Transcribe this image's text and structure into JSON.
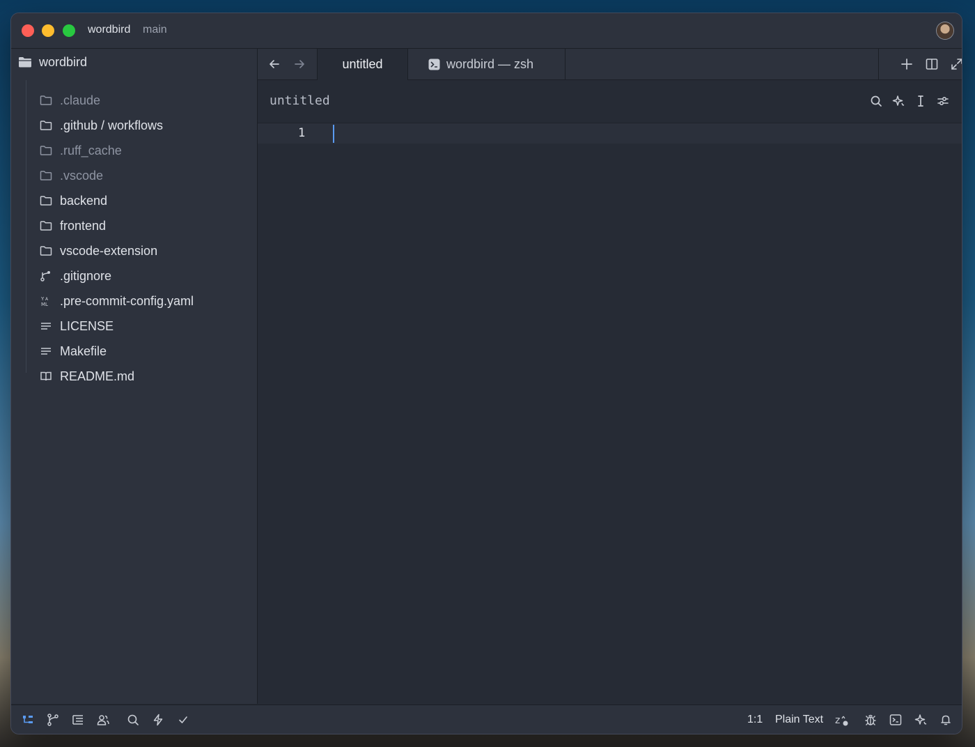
{
  "titlebar": {
    "project": "wordbird",
    "branch": "main"
  },
  "sidebar": {
    "root": "wordbird",
    "items": [
      {
        "label": ".claude",
        "icon": "folder-icon",
        "dim": true
      },
      {
        "label": ".github / workflows",
        "icon": "folder-icon",
        "dim": false
      },
      {
        "label": ".ruff_cache",
        "icon": "folder-icon",
        "dim": true
      },
      {
        "label": ".vscode",
        "icon": "folder-icon",
        "dim": true
      },
      {
        "label": "backend",
        "icon": "folder-icon",
        "dim": false
      },
      {
        "label": "frontend",
        "icon": "folder-icon",
        "dim": false
      },
      {
        "label": "vscode-extension",
        "icon": "folder-icon",
        "dim": false
      },
      {
        "label": ".gitignore",
        "icon": "git-branch-icon",
        "dim": false
      },
      {
        "label": ".pre-commit-config.yaml",
        "icon": "yaml-file-icon",
        "dim": false
      },
      {
        "label": "LICENSE",
        "icon": "text-lines-icon",
        "dim": false
      },
      {
        "label": "Makefile",
        "icon": "text-lines-icon",
        "dim": false
      },
      {
        "label": "README.md",
        "icon": "book-icon",
        "dim": false
      }
    ]
  },
  "tabs": [
    {
      "label": "untitled",
      "active": true
    },
    {
      "label": "wordbird — zsh",
      "icon": "terminal-icon",
      "active": false
    }
  ],
  "editor": {
    "title": "untitled",
    "line_numbers": [
      "1"
    ]
  },
  "statusbar": {
    "position": "1:1",
    "language": "Plain Text"
  },
  "colors": {
    "accent": "#5a9af0",
    "background": "#262b35",
    "panel": "#2d323d"
  }
}
